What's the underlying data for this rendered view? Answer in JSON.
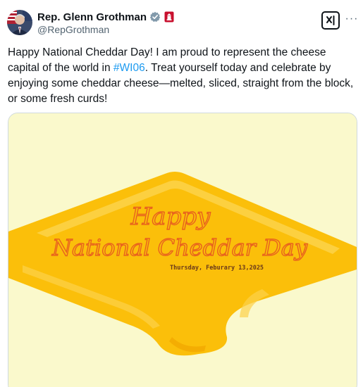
{
  "author": {
    "display_name": "Rep. Glenn Grothman",
    "handle": "@RepGrothman",
    "verified": true,
    "verified_color": "#829aab",
    "badge_icon": "congress-badge-icon",
    "badge_color": "#c8102e"
  },
  "header_actions": {
    "grok_icon": "grok-icon",
    "more_icon": "more-icon",
    "more_label": "···"
  },
  "tweet": {
    "text_before": "Happy National Cheddar Day! I am proud to represent the cheese capital of the world in ",
    "hashtag": "#WI06",
    "text_after": ". Treat yourself today and celebrate by enjoying some cheddar cheese—melted, sliced, straight from the block, or some fresh curds!",
    "hashtag_color": "#1d9bf0"
  },
  "media": {
    "heading_line1": "Happy",
    "heading_line2": "National Cheddar Day",
    "date": "Thursday, Feburary 13,2025",
    "background_color": "#faf9cc",
    "cheese_color": "#fbbf0a",
    "text_color": "#e8611e"
  }
}
